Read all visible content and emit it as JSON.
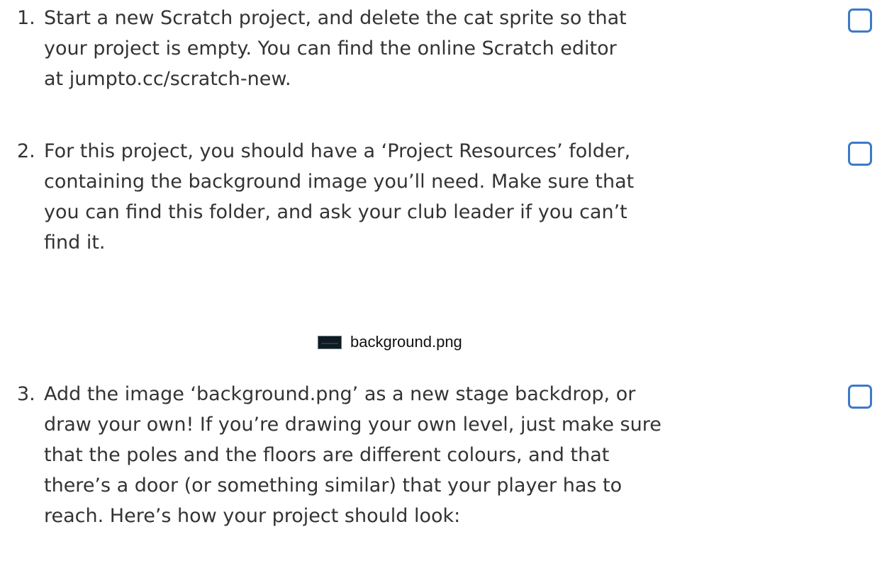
{
  "steps": [
    {
      "number": "1.",
      "lines": [
        "Start a new Scratch project, and delete the cat sprite so that",
        "your project is empty. You can find the online Scratch editor",
        "at jumpto.cc/scratch-new."
      ],
      "checked": false
    },
    {
      "number": "2.",
      "lines": [
        "For this project, you should have a ‘Project Resources’ folder,",
        "containing the background image you’ll need. Make sure that",
        "you can find this folder, and ask your club leader if you can’t",
        "find it."
      ],
      "checked": false
    },
    {
      "number": "3.",
      "lines": [
        "Add the image ‘background.png’ as a new stage backdrop, or",
        "draw your own! If you’re drawing your own level, just make sure",
        "that the poles and the floors are different colours, and that",
        "there’s a door (or something similar) that your player has to",
        "reach. Here’s how your project should look:"
      ],
      "checked": false
    }
  ],
  "resource_file": {
    "icon": "image-file-icon",
    "name": "background.png"
  },
  "colors": {
    "checkbox_border": "#3a7ac8",
    "text": "#333333"
  }
}
